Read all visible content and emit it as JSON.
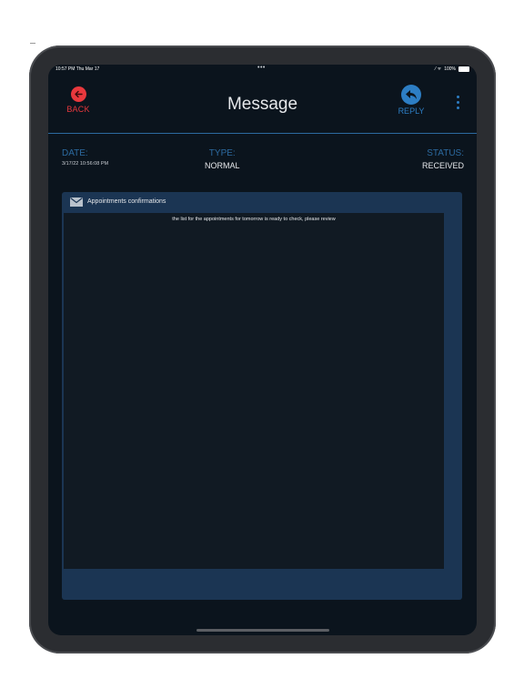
{
  "status_bar": {
    "time": "10:57 PM  Thu Mar 17",
    "dots": "•••",
    "signal": "⁄ ᯤ",
    "battery": "100%"
  },
  "header": {
    "back_label": "BACK",
    "title": "Message",
    "reply_label": "REPLY",
    "more_icon": "more-vertical-icon"
  },
  "meta": {
    "date_label": "DATE:",
    "date_value": "3/17/22 10:56:08 PM",
    "type_label": "TYPE:",
    "type_value": "NORMAL",
    "status_label": "STATUS:",
    "status_value": "RECEIVED"
  },
  "message": {
    "subject": "Appointments confirmations",
    "body": "the list for the appointments for tomorrow is ready to check, please review"
  },
  "colors": {
    "accent_blue": "#2d7ec4",
    "back_red": "#e8383d",
    "background": "#0b141d",
    "panel": "#1b3553"
  }
}
